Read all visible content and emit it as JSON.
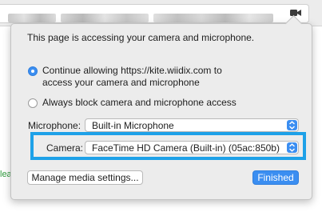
{
  "popover": {
    "heading": "This page is accessing your camera and microphone.",
    "option_allow": {
      "line1": "Continue allowing https://kite.wiidix.com to",
      "line2": "access your camera and microphone",
      "selected": true
    },
    "option_block": {
      "label": "Always block camera and microphone access",
      "selected": false
    },
    "microphone": {
      "label": "Microphone:",
      "value": "Built-in Microphone"
    },
    "camera": {
      "label": "Camera:",
      "value": "FaceTime HD Camera (Built-in) (05ac:850b)"
    },
    "manage_button": "Manage media settings...",
    "finished_button": "Finished"
  },
  "page_background_fragment": "lea",
  "colors": {
    "accent": "#3b8ef1",
    "highlight": "#1ea1e8",
    "popover_bg": "#ececec",
    "page_text_green": "#2e9a3c"
  },
  "icons": {
    "camera_indicator": "video-camera-icon",
    "select_stepper": "chevron-up-down-icon"
  }
}
